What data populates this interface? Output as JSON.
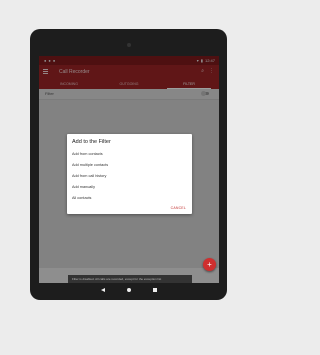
{
  "status_bar": {
    "left_icons": [
      "notification-icon",
      "notification-icon",
      "notification-icon"
    ],
    "time": "12:47"
  },
  "app_bar": {
    "title": "Call Recorder",
    "actions": [
      "search-icon",
      "more-icon"
    ]
  },
  "tabs": [
    {
      "label": "INCOMING",
      "active": false
    },
    {
      "label": "OUTGOING",
      "active": false
    },
    {
      "label": "FILTER",
      "active": true
    }
  ],
  "filter_row": {
    "label": "Filter",
    "toggle_on": false
  },
  "dialog": {
    "title": "Add to the Filter",
    "options": [
      "Add from contacts",
      "Add multiple contacts",
      "Add from call history",
      "Add manually",
      "All contacts"
    ],
    "cancel_label": "CANCEL"
  },
  "fab": {
    "symbol": "+"
  },
  "snackbar": {
    "text": "Filter is disabled. All calls are recorded, except for the exception list"
  },
  "colors": {
    "primary": "#9b2426",
    "accent": "#cf2f2f"
  }
}
